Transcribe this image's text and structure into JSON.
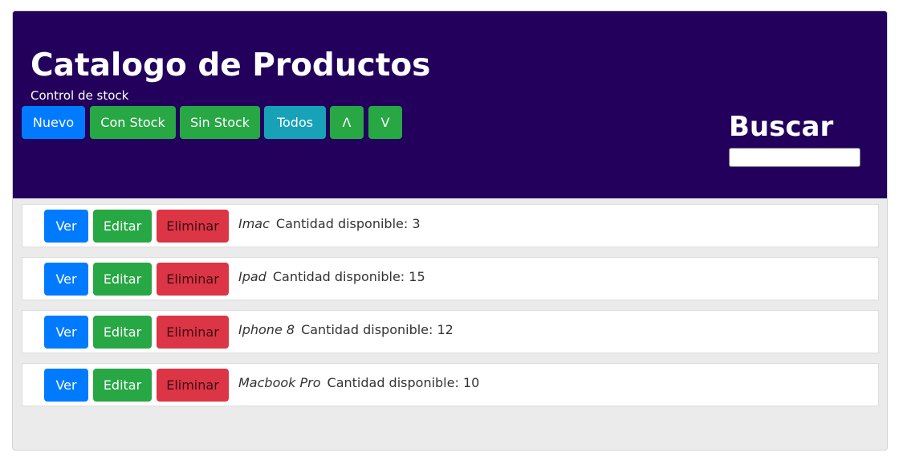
{
  "header": {
    "title": "Catalogo de Productos",
    "subtitle": "Control de stock",
    "buttons": {
      "nuevo": "Nuevo",
      "con_stock": "Con Stock",
      "sin_stock": "Sin Stock",
      "todos": "Todos",
      "sort_up": "Λ",
      "sort_down": "V"
    },
    "search": {
      "label": "Buscar",
      "value": ""
    }
  },
  "products": [
    {
      "name": "Imac",
      "quantity_label": "Cantidad disponible: 3"
    },
    {
      "name": "Ipad",
      "quantity_label": "Cantidad disponible: 15"
    },
    {
      "name": "Iphone 8",
      "quantity_label": "Cantidad disponible: 12"
    },
    {
      "name": "Macbook Pro",
      "quantity_label": "Cantidad disponible: 10"
    }
  ],
  "row_buttons": {
    "ver": "Ver",
    "editar": "Editar",
    "eliminar": "Eliminar"
  },
  "colors": {
    "header_bg": "#22005c",
    "primary": "#007bff",
    "success": "#28a745",
    "info": "#17a2b8",
    "danger": "#dc3545"
  }
}
